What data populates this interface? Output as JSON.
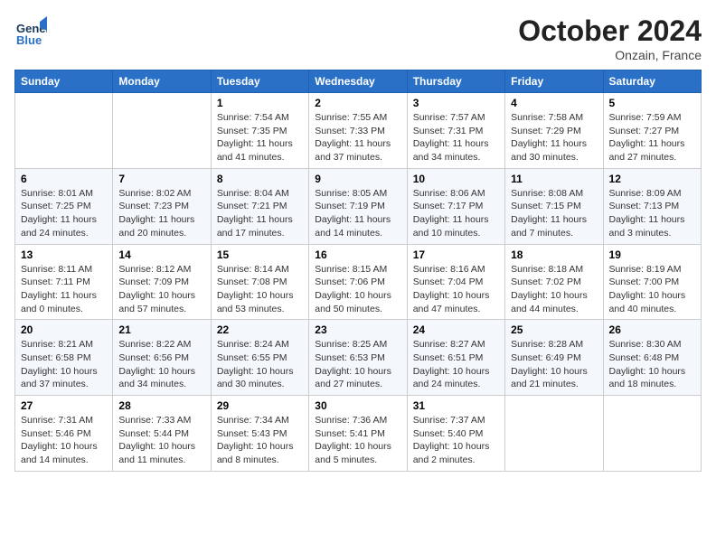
{
  "header": {
    "logo_general": "General",
    "logo_blue": "Blue",
    "month_title": "October 2024",
    "location": "Onzain, France"
  },
  "days_of_week": [
    "Sunday",
    "Monday",
    "Tuesday",
    "Wednesday",
    "Thursday",
    "Friday",
    "Saturday"
  ],
  "weeks": [
    [
      {
        "day": "",
        "info": ""
      },
      {
        "day": "",
        "info": ""
      },
      {
        "day": "1",
        "info": "Sunrise: 7:54 AM\nSunset: 7:35 PM\nDaylight: 11 hours and 41 minutes."
      },
      {
        "day": "2",
        "info": "Sunrise: 7:55 AM\nSunset: 7:33 PM\nDaylight: 11 hours and 37 minutes."
      },
      {
        "day": "3",
        "info": "Sunrise: 7:57 AM\nSunset: 7:31 PM\nDaylight: 11 hours and 34 minutes."
      },
      {
        "day": "4",
        "info": "Sunrise: 7:58 AM\nSunset: 7:29 PM\nDaylight: 11 hours and 30 minutes."
      },
      {
        "day": "5",
        "info": "Sunrise: 7:59 AM\nSunset: 7:27 PM\nDaylight: 11 hours and 27 minutes."
      }
    ],
    [
      {
        "day": "6",
        "info": "Sunrise: 8:01 AM\nSunset: 7:25 PM\nDaylight: 11 hours and 24 minutes."
      },
      {
        "day": "7",
        "info": "Sunrise: 8:02 AM\nSunset: 7:23 PM\nDaylight: 11 hours and 20 minutes."
      },
      {
        "day": "8",
        "info": "Sunrise: 8:04 AM\nSunset: 7:21 PM\nDaylight: 11 hours and 17 minutes."
      },
      {
        "day": "9",
        "info": "Sunrise: 8:05 AM\nSunset: 7:19 PM\nDaylight: 11 hours and 14 minutes."
      },
      {
        "day": "10",
        "info": "Sunrise: 8:06 AM\nSunset: 7:17 PM\nDaylight: 11 hours and 10 minutes."
      },
      {
        "day": "11",
        "info": "Sunrise: 8:08 AM\nSunset: 7:15 PM\nDaylight: 11 hours and 7 minutes."
      },
      {
        "day": "12",
        "info": "Sunrise: 8:09 AM\nSunset: 7:13 PM\nDaylight: 11 hours and 3 minutes."
      }
    ],
    [
      {
        "day": "13",
        "info": "Sunrise: 8:11 AM\nSunset: 7:11 PM\nDaylight: 11 hours and 0 minutes."
      },
      {
        "day": "14",
        "info": "Sunrise: 8:12 AM\nSunset: 7:09 PM\nDaylight: 10 hours and 57 minutes."
      },
      {
        "day": "15",
        "info": "Sunrise: 8:14 AM\nSunset: 7:08 PM\nDaylight: 10 hours and 53 minutes."
      },
      {
        "day": "16",
        "info": "Sunrise: 8:15 AM\nSunset: 7:06 PM\nDaylight: 10 hours and 50 minutes."
      },
      {
        "day": "17",
        "info": "Sunrise: 8:16 AM\nSunset: 7:04 PM\nDaylight: 10 hours and 47 minutes."
      },
      {
        "day": "18",
        "info": "Sunrise: 8:18 AM\nSunset: 7:02 PM\nDaylight: 10 hours and 44 minutes."
      },
      {
        "day": "19",
        "info": "Sunrise: 8:19 AM\nSunset: 7:00 PM\nDaylight: 10 hours and 40 minutes."
      }
    ],
    [
      {
        "day": "20",
        "info": "Sunrise: 8:21 AM\nSunset: 6:58 PM\nDaylight: 10 hours and 37 minutes."
      },
      {
        "day": "21",
        "info": "Sunrise: 8:22 AM\nSunset: 6:56 PM\nDaylight: 10 hours and 34 minutes."
      },
      {
        "day": "22",
        "info": "Sunrise: 8:24 AM\nSunset: 6:55 PM\nDaylight: 10 hours and 30 minutes."
      },
      {
        "day": "23",
        "info": "Sunrise: 8:25 AM\nSunset: 6:53 PM\nDaylight: 10 hours and 27 minutes."
      },
      {
        "day": "24",
        "info": "Sunrise: 8:27 AM\nSunset: 6:51 PM\nDaylight: 10 hours and 24 minutes."
      },
      {
        "day": "25",
        "info": "Sunrise: 8:28 AM\nSunset: 6:49 PM\nDaylight: 10 hours and 21 minutes."
      },
      {
        "day": "26",
        "info": "Sunrise: 8:30 AM\nSunset: 6:48 PM\nDaylight: 10 hours and 18 minutes."
      }
    ],
    [
      {
        "day": "27",
        "info": "Sunrise: 7:31 AM\nSunset: 5:46 PM\nDaylight: 10 hours and 14 minutes."
      },
      {
        "day": "28",
        "info": "Sunrise: 7:33 AM\nSunset: 5:44 PM\nDaylight: 10 hours and 11 minutes."
      },
      {
        "day": "29",
        "info": "Sunrise: 7:34 AM\nSunset: 5:43 PM\nDaylight: 10 hours and 8 minutes."
      },
      {
        "day": "30",
        "info": "Sunrise: 7:36 AM\nSunset: 5:41 PM\nDaylight: 10 hours and 5 minutes."
      },
      {
        "day": "31",
        "info": "Sunrise: 7:37 AM\nSunset: 5:40 PM\nDaylight: 10 hours and 2 minutes."
      },
      {
        "day": "",
        "info": ""
      },
      {
        "day": "",
        "info": ""
      }
    ]
  ]
}
